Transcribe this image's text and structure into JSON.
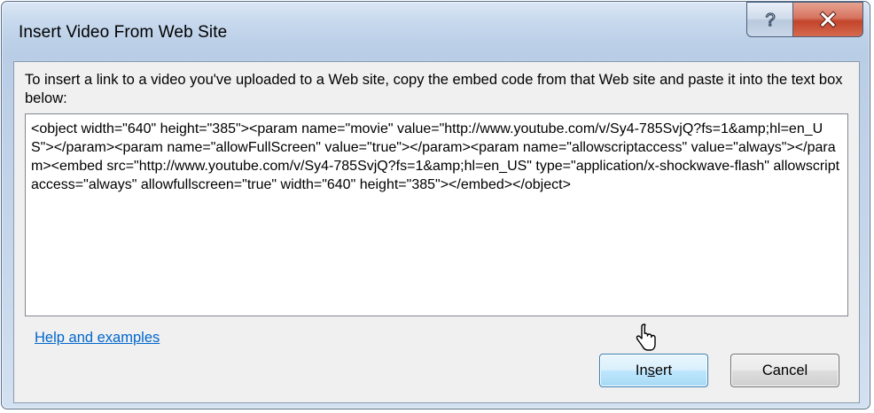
{
  "window": {
    "title": "Insert Video From Web Site",
    "help_glyph": "?",
    "close_glyph": "X"
  },
  "dialog": {
    "instructions": "To insert a link to a video you've uploaded to a Web site, copy the embed code from that Web site and paste it into the text box below:",
    "embed_code": "<object width=\"640\" height=\"385\"><param name=\"movie\" value=\"http://www.youtube.com/v/Sy4-785SvjQ?fs=1&amp;hl=en_US\"></param><param name=\"allowFullScreen\" value=\"true\"></param><param name=\"allowscriptaccess\" value=\"always\"></param><embed src=\"http://www.youtube.com/v/Sy4-785SvjQ?fs=1&amp;hl=en_US\" type=\"application/x-shockwave-flash\" allowscriptaccess=\"always\" allowfullscreen=\"true\" width=\"640\" height=\"385\"></embed></object>",
    "help_link": "Help and examples",
    "insert_button": {
      "label": "Insert",
      "accesskey_letter": "s"
    },
    "cancel_button": "Cancel"
  },
  "icons": {
    "help": "help-question-icon",
    "close": "close-x-icon",
    "cursor": "mouse-pointer-icon"
  }
}
